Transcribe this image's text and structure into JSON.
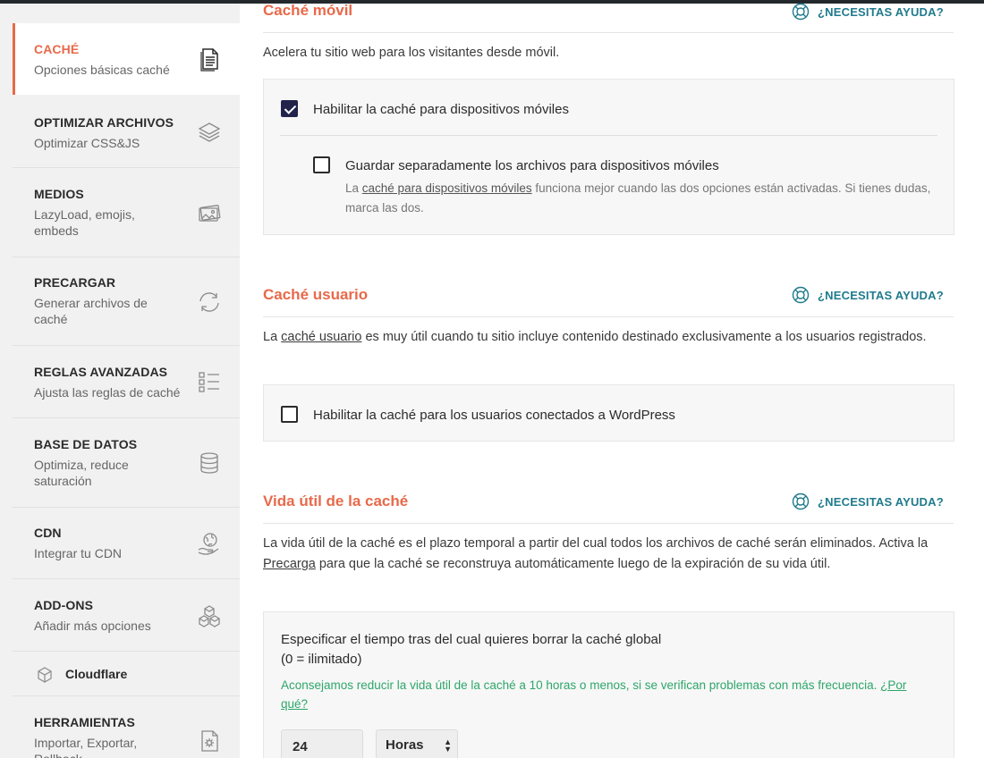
{
  "sidebar": {
    "items": [
      {
        "title": "CACHÉ",
        "sub": "Opciones básicas caché",
        "icon": "document-icon"
      },
      {
        "title": "OPTIMIZAR ARCHIVOS",
        "sub": "Optimizar CSS&JS",
        "icon": "layers-icon"
      },
      {
        "title": "MEDIOS",
        "sub": "LazyLoad, emojis, embeds",
        "icon": "images-icon"
      },
      {
        "title": "PRECARGAR",
        "sub": "Generar archivos de caché",
        "icon": "refresh-icon"
      },
      {
        "title": "REGLAS AVANZADAS",
        "sub": "Ajusta las reglas de caché",
        "icon": "checklist-icon"
      },
      {
        "title": "BASE DE DATOS",
        "sub": "Optimiza, reduce saturación",
        "icon": "database-icon"
      },
      {
        "title": "CDN",
        "sub": "Integrar tu CDN",
        "icon": "globe-hand-icon"
      },
      {
        "title": "ADD-ONS",
        "sub": "Añadir más opciones",
        "icon": "cubes-icon"
      },
      {
        "title": "HERRAMIENTAS",
        "sub": "Importar, Exportar, Rollback",
        "icon": "gear-file-icon"
      }
    ],
    "cloudflare": {
      "label": "Cloudflare",
      "icon": "cube-icon"
    }
  },
  "help_label": "¿NECESITAS AYUDA?",
  "mobile": {
    "title": "Caché móvil",
    "desc": "Acelera tu sitio web para los visitantes desde móvil.",
    "opt1": "Habilitar la caché para dispositivos móviles",
    "opt1_checked": true,
    "opt2": "Guardar separadamente los archivos para dispositivos móviles",
    "opt2_checked": false,
    "note_pre": "La ",
    "note_link": "caché para dispositivos móviles",
    "note_post": " funciona mejor cuando las dos opciones están activadas. Si tienes dudas, marca las dos."
  },
  "user": {
    "title": "Caché usuario",
    "desc_pre": "La ",
    "desc_link": "caché usuario",
    "desc_post": " es muy útil cuando tu sitio incluye contenido destinado exclusivamente a los usuarios registrados.",
    "opt": "Habilitar la caché para los usuarios conectados a WordPress",
    "opt_checked": false
  },
  "lifespan": {
    "title": "Vida útil de la caché",
    "desc1": "La vida útil de la caché es el plazo temporal a partir del cual todos los archivos de caché serán eliminados.",
    "desc2_pre": "Activa la ",
    "desc2_link": "Precarga",
    "desc2_post": " para que la caché se reconstruya automáticamente luego de la expiración de su vida útil.",
    "field_label1": "Especificar el tiempo tras del cual quieres borrar la caché global",
    "field_label2": "(0 = ilimitado)",
    "advice": "Aconsejamos reducir la vida útil de la caché a 10 horas o menos, si se verifican problemas con más frecuencia.",
    "advice_link": "¿Por qué?",
    "value": "24",
    "unit": "Horas"
  },
  "colors": {
    "accent": "#e8694a",
    "help": "#1f7a8c",
    "checkbox": "#22234b",
    "advice": "#2ea66a"
  }
}
